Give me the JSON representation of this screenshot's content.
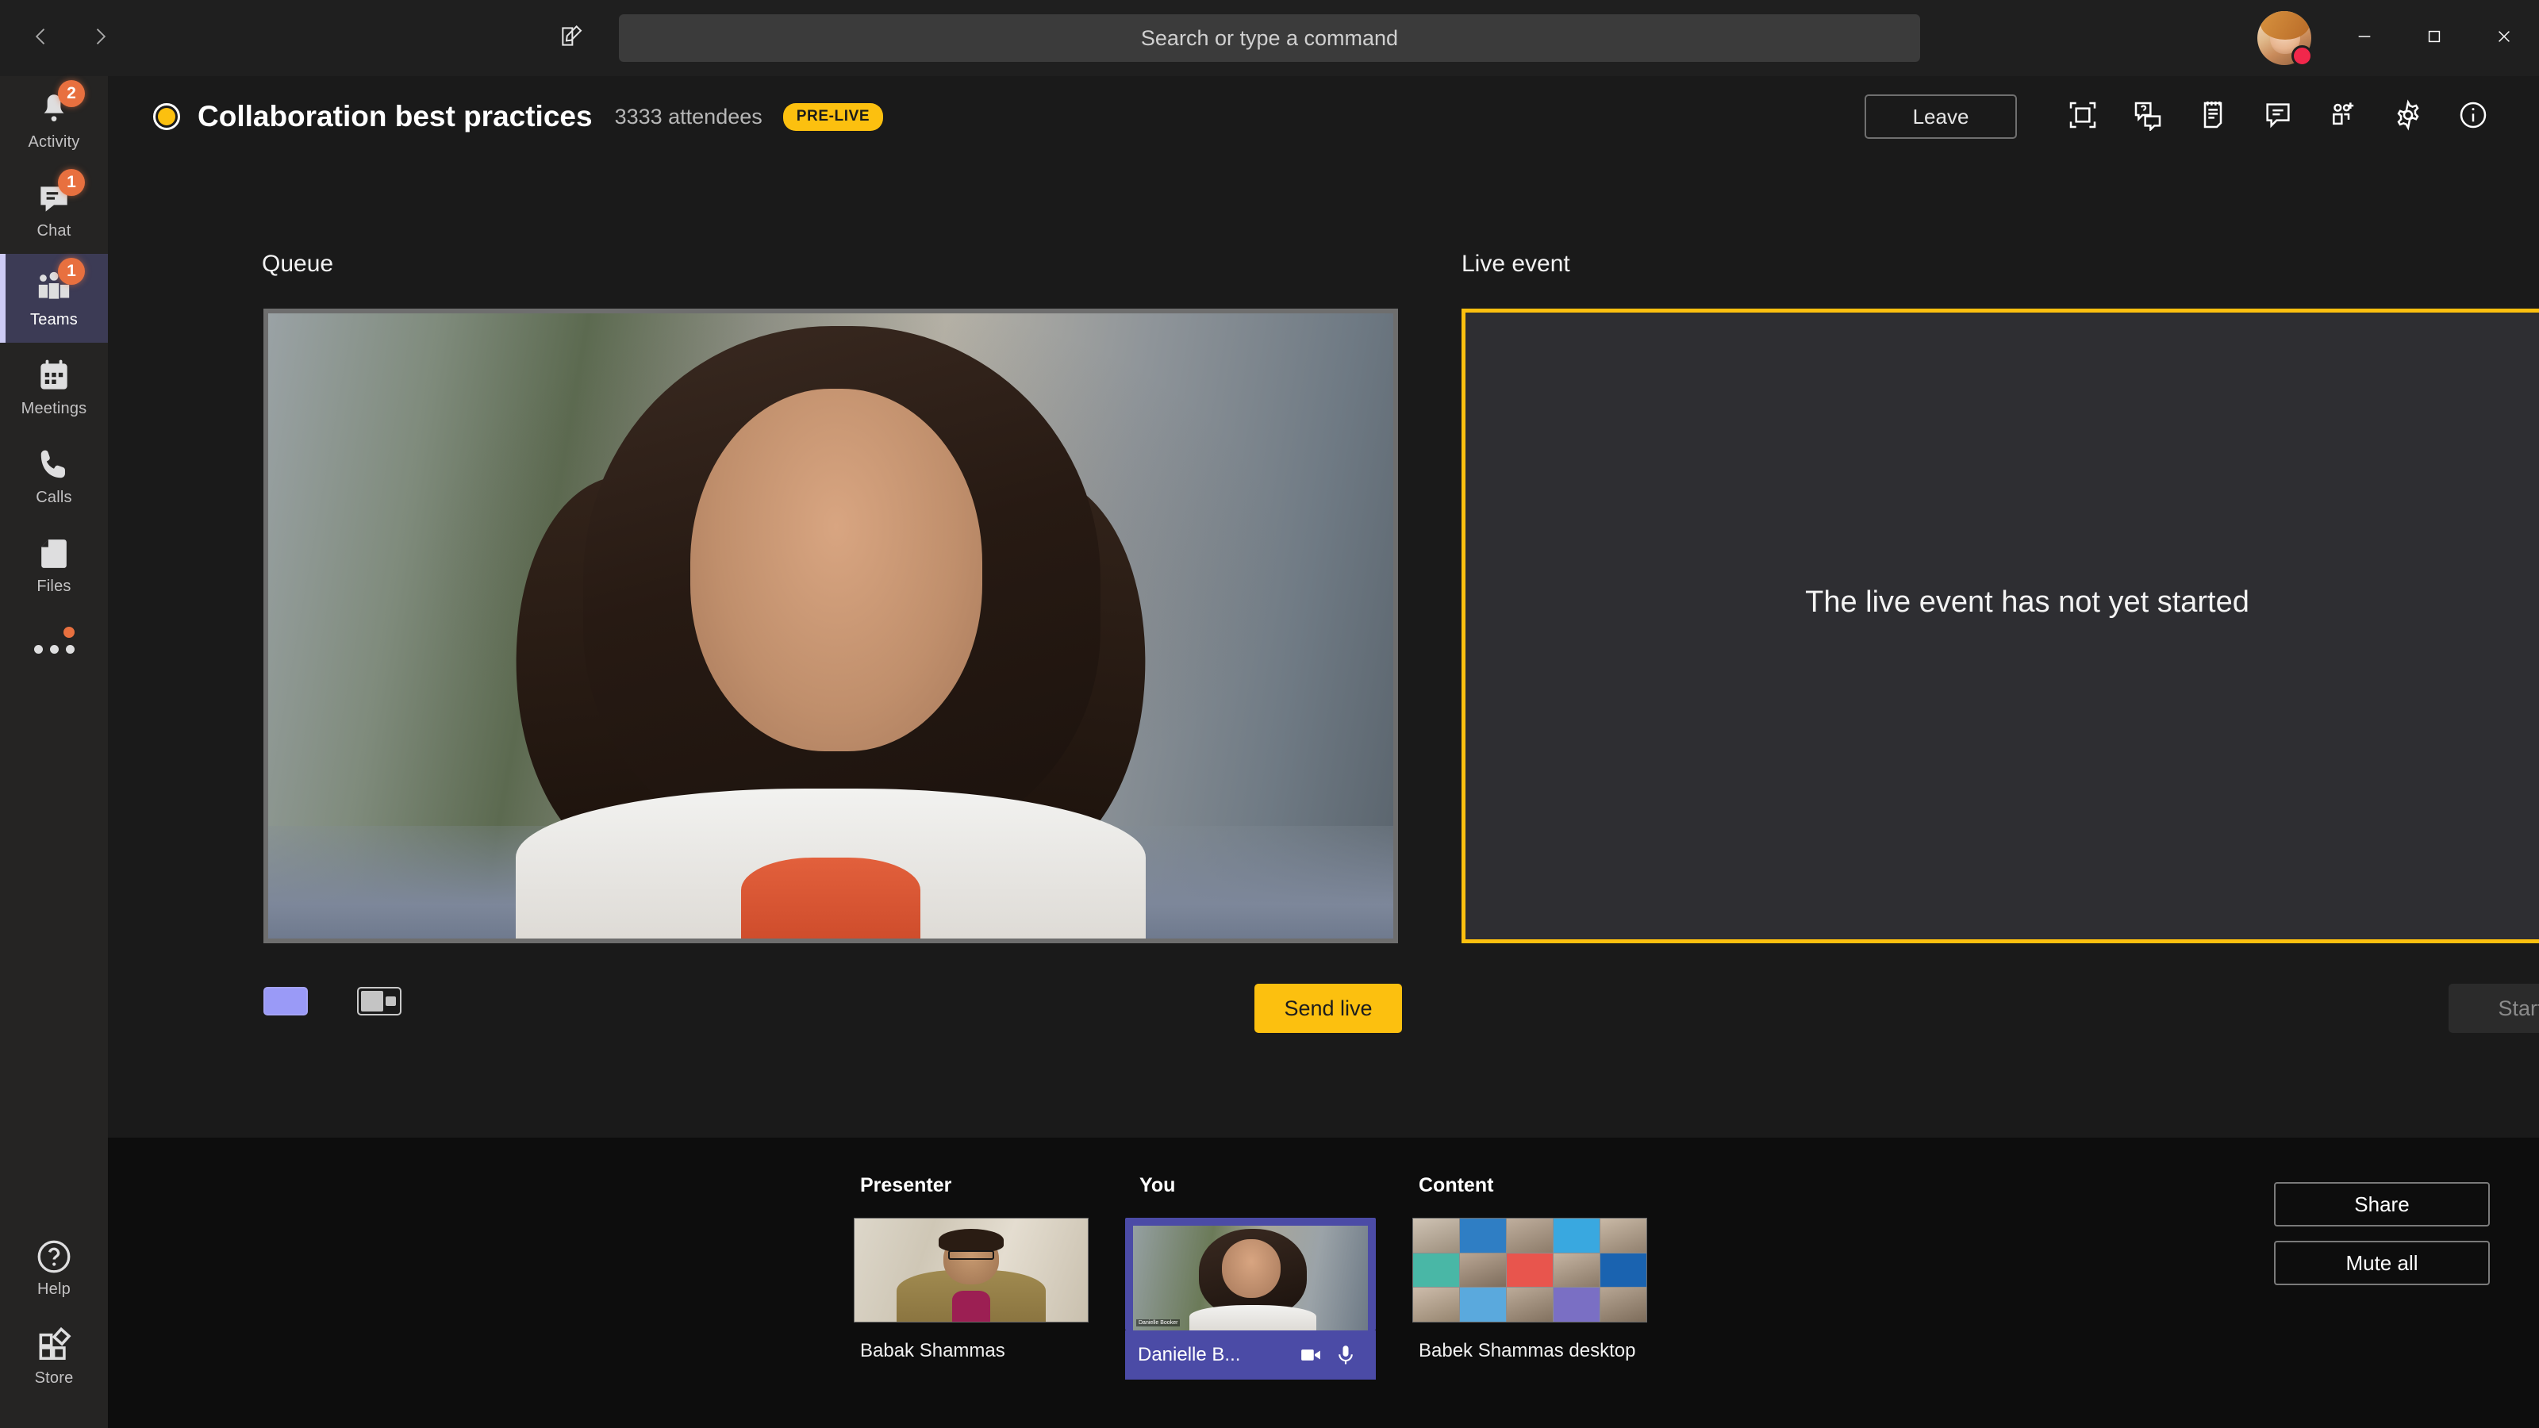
{
  "titlebar": {
    "back_icon": "chevron-left-icon",
    "forward_icon": "chevron-right-icon",
    "compose_icon": "compose-icon",
    "search_placeholder": "Search or type a command",
    "avatar_presence": "busy",
    "minimize_label": "Minimize",
    "maximize_label": "Maximize",
    "close_label": "Close"
  },
  "rail": {
    "items": [
      {
        "label": "Activity",
        "icon": "bell-icon",
        "badge": "2",
        "active": false
      },
      {
        "label": "Chat",
        "icon": "chat-icon",
        "badge": "1",
        "active": false
      },
      {
        "label": "Teams",
        "icon": "teams-icon",
        "badge": "1",
        "active": true
      },
      {
        "label": "Meetings",
        "icon": "calendar-icon",
        "badge": "",
        "active": false
      },
      {
        "label": "Calls",
        "icon": "phone-icon",
        "badge": "",
        "active": false
      },
      {
        "label": "Files",
        "icon": "files-icon",
        "badge": "",
        "active": false
      }
    ],
    "more_icon": "ellipsis-icon",
    "bottom": [
      {
        "label": "Help",
        "icon": "help-icon"
      },
      {
        "label": "Store",
        "icon": "store-icon"
      }
    ]
  },
  "event": {
    "status_color": "#fcc00f",
    "title": "Collaboration best practices",
    "attendees": "3333 attendees",
    "state_badge": "PRE-LIVE",
    "leave_label": "Leave",
    "header_icons": [
      "fit-to-screen-icon",
      "qna-icon",
      "notes-icon",
      "meeting-chat-icon",
      "add-participant-icon",
      "settings-gear-icon",
      "info-icon"
    ]
  },
  "queue": {
    "label": "Queue",
    "border_color": "#6e6e6e",
    "layout_buttons": [
      {
        "name": "single-layout",
        "selected": true
      },
      {
        "name": "pip-layout",
        "selected": false
      }
    ],
    "send_live_label": "Send live",
    "send_live_color": "#fcc00f"
  },
  "live": {
    "label": "Live event",
    "border_color": "#fcc00f",
    "message": "The live event has not yet started",
    "start_label": "Start",
    "start_disabled": true
  },
  "tray": {
    "tiles": [
      {
        "heading": "Presenter",
        "name": "Babak Shammas",
        "selected": false,
        "art": "man"
      },
      {
        "heading": "You",
        "name": "Danielle B...",
        "selected": true,
        "art": "woman",
        "camera_icon": "camera-icon",
        "mic_icon": "microphone-icon"
      },
      {
        "heading": "Content",
        "name": "Babek Shammas desktop",
        "selected": false,
        "art": "grid"
      }
    ],
    "share_label": "Share",
    "mute_all_label": "Mute all",
    "selected_color": "#4b4ba6"
  }
}
